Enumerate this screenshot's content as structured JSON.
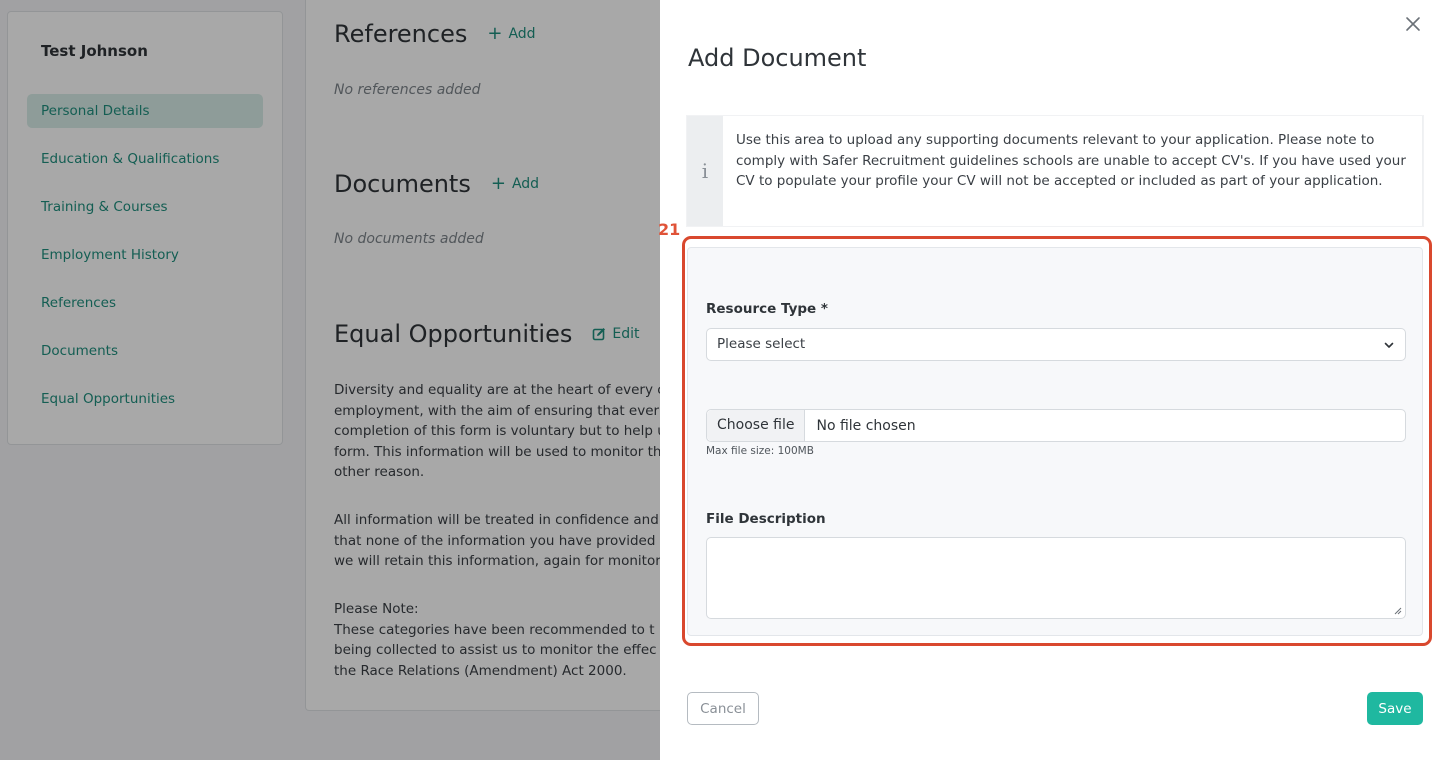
{
  "sidebar": {
    "user_name": "Test Johnson",
    "items": [
      {
        "label": "Personal Details",
        "active": true
      },
      {
        "label": "Education & Qualifications"
      },
      {
        "label": "Training & Courses"
      },
      {
        "label": "Employment History"
      },
      {
        "label": "References"
      },
      {
        "label": "Documents"
      },
      {
        "label": "Equal Opportunities"
      }
    ]
  },
  "main": {
    "references": {
      "title": "References",
      "action": "Add",
      "empty": "No references added"
    },
    "documents": {
      "title": "Documents",
      "action": "Add",
      "empty": "No documents added"
    },
    "equal_opportunities": {
      "title": "Equal Opportunities",
      "action": "Edit",
      "para1": [
        "Diversity and equality are at the heart of every c",
        "employment, with the aim of ensuring that ever",
        "completion of this form is voluntary but to help u",
        "form. This information will be used to monitor th",
        "other reason."
      ],
      "para2": [
        "All information will be treated in confidence and",
        "that none of the information you have provided",
        "we will retain this information, again for monitor"
      ],
      "para3": [
        "Please Note:",
        "These categories have been recommended to t",
        "being collected to assist us to monitor the effec",
        "the Race Relations (Amendment) Act 2000."
      ]
    }
  },
  "drawer": {
    "title": "Add Document",
    "info_icon": "info-icon",
    "info_text": "Use this area to upload any supporting documents relevant to your application. Please note to comply with Safer Recruitment guidelines schools are unable to accept CV's. If you have used your CV to populate your profile your CV will not be accepted or included as part of your application.",
    "annotation_label": "21",
    "form": {
      "resource_type_label": "Resource Type *",
      "resource_type_value": "Please select",
      "file_button": "Choose file",
      "file_status": "No file chosen",
      "file_hint": "Max file size: 100MB",
      "description_label": "File Description",
      "description_value": ""
    },
    "cancel_label": "Cancel",
    "save_label": "Save"
  },
  "colors": {
    "accent": "#1fb8a0",
    "link": "#1f8f7e",
    "annotation": "#d9482e"
  }
}
